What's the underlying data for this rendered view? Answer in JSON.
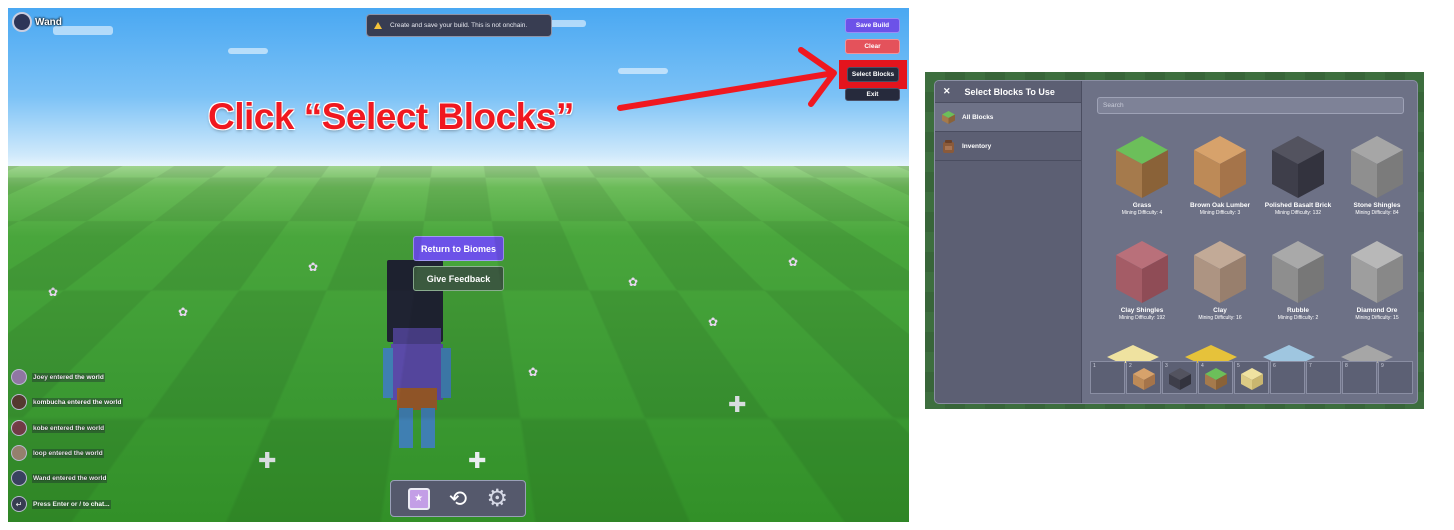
{
  "game": {
    "user": {
      "name": "Wand"
    },
    "toast": {
      "icon": "warning-icon",
      "text": "Create and save your build. This is not onchain."
    },
    "side_menu": {
      "save_build": "Save Build",
      "clear": "Clear",
      "select_blocks": "Select Blocks",
      "exit": "Exit"
    },
    "annotation": {
      "text": "Click “Select Blocks”",
      "color": "#f01820"
    },
    "center_menu": {
      "return_label": "Return to Biomes",
      "feedback_label": "Give Feedback"
    },
    "chat": {
      "messages": [
        {
          "name": "Joey",
          "text": "Joey entered the world",
          "color": "#9b7fb0"
        },
        {
          "name": "kombucha",
          "text": "kombucha entered the world",
          "color": "#5a3d32"
        },
        {
          "name": "kobe",
          "text": "kobe entered the world",
          "color": "#7a3f4a"
        },
        {
          "name": "loop",
          "text": "loop entered the world",
          "color": "#a08a75"
        },
        {
          "name": "Wand",
          "text": "Wand entered the world",
          "color": "#3d4666"
        }
      ],
      "input_hint": "Press Enter or / to chat..."
    },
    "hotbar": {
      "items": [
        "book-icon",
        "cycle-icon",
        "gear-icon"
      ]
    }
  },
  "dialog": {
    "title": "Select Blocks To Use",
    "categories": [
      {
        "label": "All Blocks",
        "icon": "grass-block-icon",
        "active": true
      },
      {
        "label": "Inventory",
        "icon": "backpack-icon",
        "active": false
      }
    ],
    "search_placeholder": "Search",
    "blocks": [
      {
        "name": "Grass",
        "difficulty": "Mining Difficulty: 4",
        "top": "#6cbf5a",
        "left": "#a57a4c",
        "right": "#8a6238"
      },
      {
        "name": "Brown Oak Lumber",
        "difficulty": "Mining Difficulty: 3",
        "top": "#d7a26b",
        "left": "#bd8a57",
        "right": "#a5744a"
      },
      {
        "name": "Polished Basalt Brick",
        "difficulty": "Mining Difficulty: 132",
        "top": "#53535f",
        "left": "#3e3e4a",
        "right": "#33333e"
      },
      {
        "name": "Stone Shingles",
        "difficulty": "Mining Difficulty: 84",
        "top": "#a6a6a6",
        "left": "#8f8f8f",
        "right": "#7b7b7b"
      },
      {
        "name": "Clay Shingles",
        "difficulty": "Mining Difficulty: 192",
        "top": "#b9707a",
        "left": "#a45c66",
        "right": "#8f4c56"
      },
      {
        "name": "Clay",
        "difficulty": "Mining Difficulty: 16",
        "top": "#c2aa97",
        "left": "#ad9482",
        "right": "#987f6d"
      },
      {
        "name": "Rubble",
        "difficulty": "Mining Difficulty: 2",
        "top": "#a9a9a9",
        "left": "#8e8e8e",
        "right": "#777777"
      },
      {
        "name": "Diamond Ore",
        "difficulty": "Mining Difficulty: 15",
        "top": "#b8b8b8",
        "left": "#9e9e9e",
        "right": "#888888"
      }
    ],
    "dock": [
      {
        "num": "1",
        "item": null
      },
      {
        "num": "2",
        "item": "brown-oak-lumber"
      },
      {
        "num": "3",
        "item": "polished-basalt-brick"
      },
      {
        "num": "4",
        "item": "grass"
      },
      {
        "num": "5",
        "item": "sandstone"
      },
      {
        "num": "6",
        "item": null
      },
      {
        "num": "7",
        "item": null
      },
      {
        "num": "8",
        "item": null
      },
      {
        "num": "9",
        "item": null
      }
    ]
  }
}
